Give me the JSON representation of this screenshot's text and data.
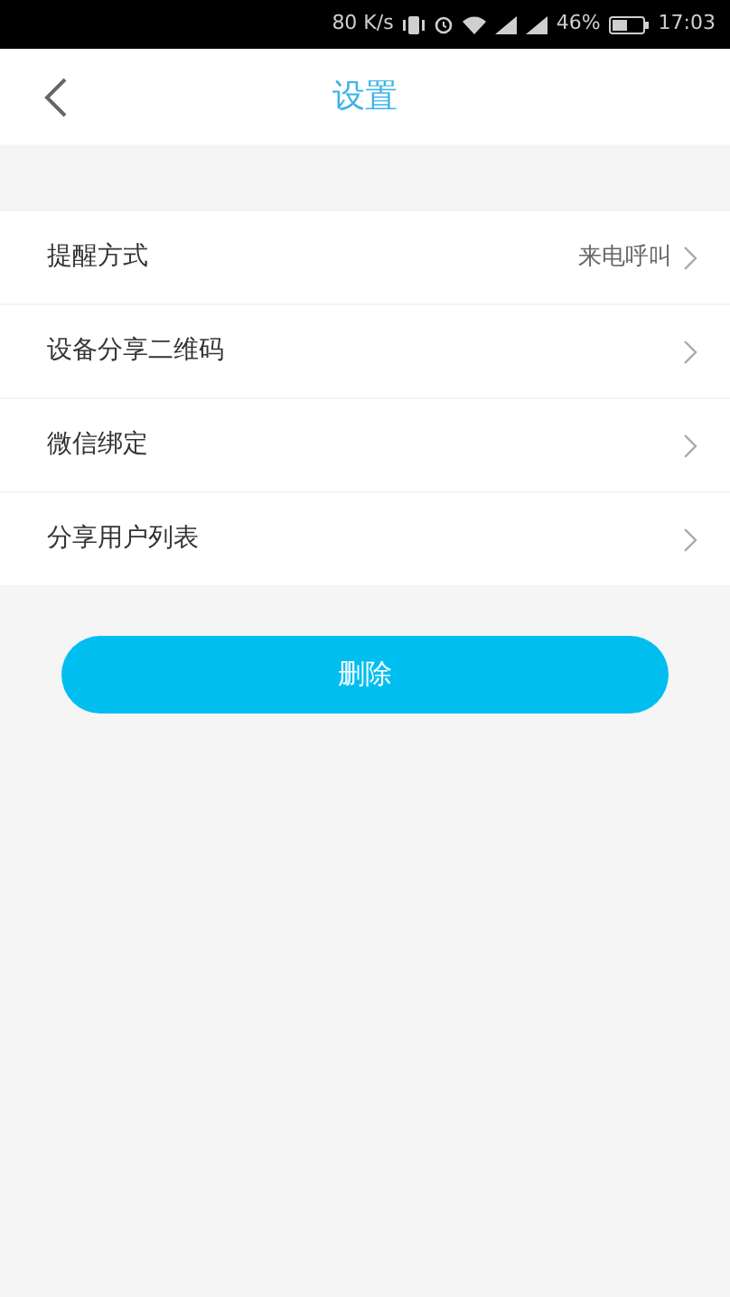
{
  "status_bar": {
    "speed": "80 K/s",
    "battery_percent": "46%",
    "time": "17:03"
  },
  "header": {
    "title": "设置"
  },
  "settings": [
    {
      "label": "提醒方式",
      "value": "来电呼叫"
    },
    {
      "label": "设备分享二维码"
    },
    {
      "label": "微信绑定"
    },
    {
      "label": "分享用户列表"
    }
  ],
  "delete_button": {
    "label": "删除"
  }
}
